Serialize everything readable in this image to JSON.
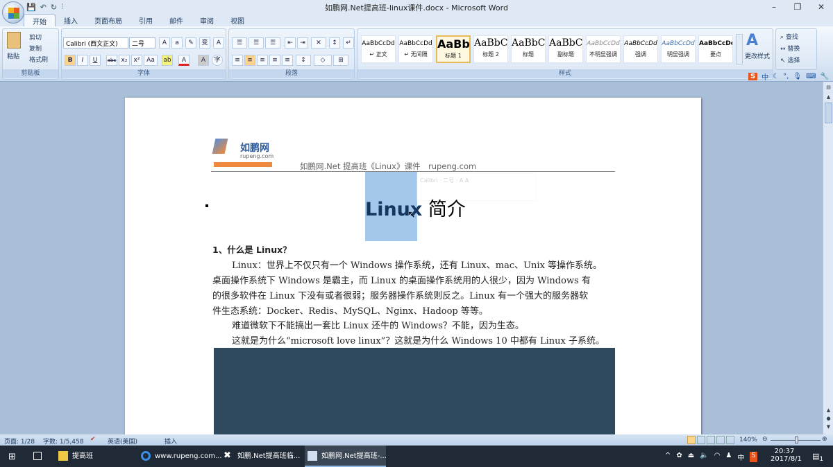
{
  "window": {
    "title": "如鹏网.Net提高班-linux课件.docx - Microsoft Word",
    "minimize": "–",
    "restore": "❐",
    "close": "✕"
  },
  "qat": {
    "save": "💾",
    "undo": "↶",
    "redo": "↻",
    "customize": "⫶"
  },
  "tabs": [
    "开始",
    "插入",
    "页面布局",
    "引用",
    "邮件",
    "审阅",
    "视图"
  ],
  "clipboard": {
    "paste": "粘贴",
    "cut": "剪切",
    "copy": "复制",
    "format_painter": "格式刷",
    "label": "剪贴板"
  },
  "font": {
    "name": "Calibri (西文正文)",
    "size": "二号",
    "label": "字体",
    "buttons": [
      "B",
      "I",
      "U",
      "abc",
      "x₂",
      "x²",
      "Aa",
      "ab",
      "A",
      "A",
      "字"
    ]
  },
  "paragraph": {
    "label": "段落"
  },
  "styles": {
    "label": "样式",
    "items": [
      {
        "preview": "AaBbCcDd",
        "name": "↵ 正文"
      },
      {
        "preview": "AaBbCcDd",
        "name": "↵ 无间隔"
      },
      {
        "preview": "AaBb",
        "name": "标题 1"
      },
      {
        "preview": "AaBbC",
        "name": "标题 2"
      },
      {
        "preview": "AaBbC",
        "name": "标题"
      },
      {
        "preview": "AaBbC",
        "name": "副标题"
      },
      {
        "preview": "AaBbCcDd",
        "name": "不明显强调"
      },
      {
        "preview": "AaBbCcDd",
        "name": "强调"
      },
      {
        "preview": "AaBbCcDd",
        "name": "明显强调"
      },
      {
        "preview": "AaBbCcDd",
        "name": "要点"
      }
    ],
    "change": "更改样式"
  },
  "editing": {
    "find": "查找",
    "replace": "替换",
    "select": "选择"
  },
  "ime": {
    "lang": "中"
  },
  "header": {
    "logo_cn": "如鹏网",
    "logo_en": "rupeng.com",
    "text": "如鹏网.Net 提高班《Linux》课件　rupeng.com"
  },
  "doc": {
    "title_en": "Linux",
    "title_cn": " 简介",
    "heading": "1、什么是 Linux？",
    "lines": [
      "Linux：世界上不仅只有一个 Windows 操作系统，还有 Linux、mac、Unix 等操作系统。",
      "桌面操作系统下 Windows 是霸主，而 Linux 的桌面操作系统用的人很少，因为 Windows 有",
      "的很多软件在 Linux 下没有或者很弱；服务器操作系统则反之。Linux 有一个强大的服务器软",
      "件生态系统：Docker、Redis、MySQL、Nginx、Hadoop 等等。",
      "难道微软下不能搞出一套比 Linux 还牛的 Windows？不能，因为生态。",
      "这就是为什么“microsoft love linux”？这就是为什么 Windows 10  中都有 Linux 子系统。"
    ]
  },
  "status": {
    "page": "页面: 1/28",
    "words": "字数: 1/5,458",
    "lang": "英语(美国)",
    "mode": "插入",
    "zoom": "140%"
  },
  "taskbar": {
    "items": [
      "提高班",
      "www.rupeng.com...",
      "如鹏.Net提高班临...",
      "如鹏网.Net提高班-..."
    ],
    "time": "20:37",
    "date": "2017/8/1",
    "ime": "中",
    "notif": "1"
  }
}
